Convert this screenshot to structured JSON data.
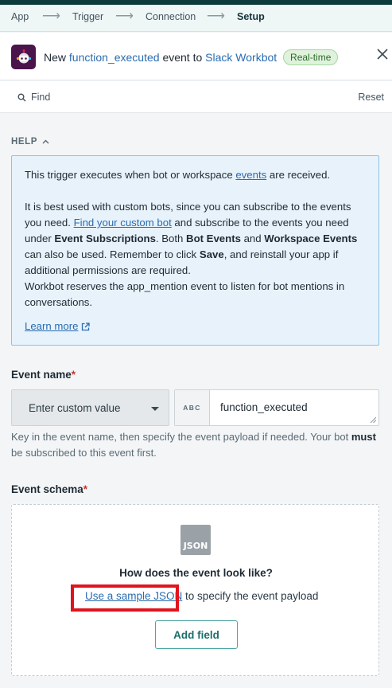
{
  "stepper": {
    "steps": [
      "App",
      "Trigger",
      "Connection",
      "Setup"
    ],
    "active": "Setup"
  },
  "header": {
    "prefix": "New",
    "event_name": "function_executed",
    "middle": "event to",
    "app_name": "Slack Workbot",
    "badge": "Real-time"
  },
  "findbar": {
    "find_label": "Find",
    "reset_label": "Reset"
  },
  "help": {
    "toggle_label": "HELP",
    "p1_before": "This trigger executes when bot or workspace ",
    "p1_link": "events",
    "p1_after": " are received.",
    "p2_a": "It is best used with custom bots, since you can subscribe to the events you need. ",
    "p2_link": "Find your custom bot",
    "p2_b": " and subscribe to the events you need under ",
    "p2_bold1": "Event Subscriptions",
    "p2_c": ". Both ",
    "p2_bold2": "Bot Events",
    "p2_d": " and ",
    "p2_bold3": "Workspace Events",
    "p2_e": " can also be used. Remember to click ",
    "p2_bold4": "Save",
    "p2_f": ", and reinstall your app if additional permissions are required.",
    "p3": "Workbot reserves the app_mention event to listen for bot mentions in conversations.",
    "learn_more": "Learn more"
  },
  "event_name": {
    "label": "Event name",
    "required_mark": "*",
    "dropdown_value": "Enter custom value",
    "type_badge": "ABC",
    "value": "function_executed",
    "hint_before": "Key in the event name, then specify the event payload if needed. Your bot ",
    "hint_bold": "must",
    "hint_after": " be subscribed to this event first."
  },
  "event_schema": {
    "label": "Event schema",
    "required_mark": "*",
    "icon_text": "JSON",
    "question": "How does the event look like?",
    "link": "Use a sample JSON",
    "after_link": " to specify the event payload",
    "add_field": "Add field"
  },
  "colors": {
    "accent": "#1b6d6a",
    "link": "#2a6cb0",
    "help_bg": "#e7f2fb",
    "highlight": "#e0141e",
    "slack_purple": "#4a154b"
  },
  "icons": [
    "slack-workbot-icon",
    "close-icon",
    "search-icon",
    "chevron-up-icon",
    "external-link-icon",
    "caret-down-icon",
    "json-icon",
    "resize-handle-icon"
  ]
}
